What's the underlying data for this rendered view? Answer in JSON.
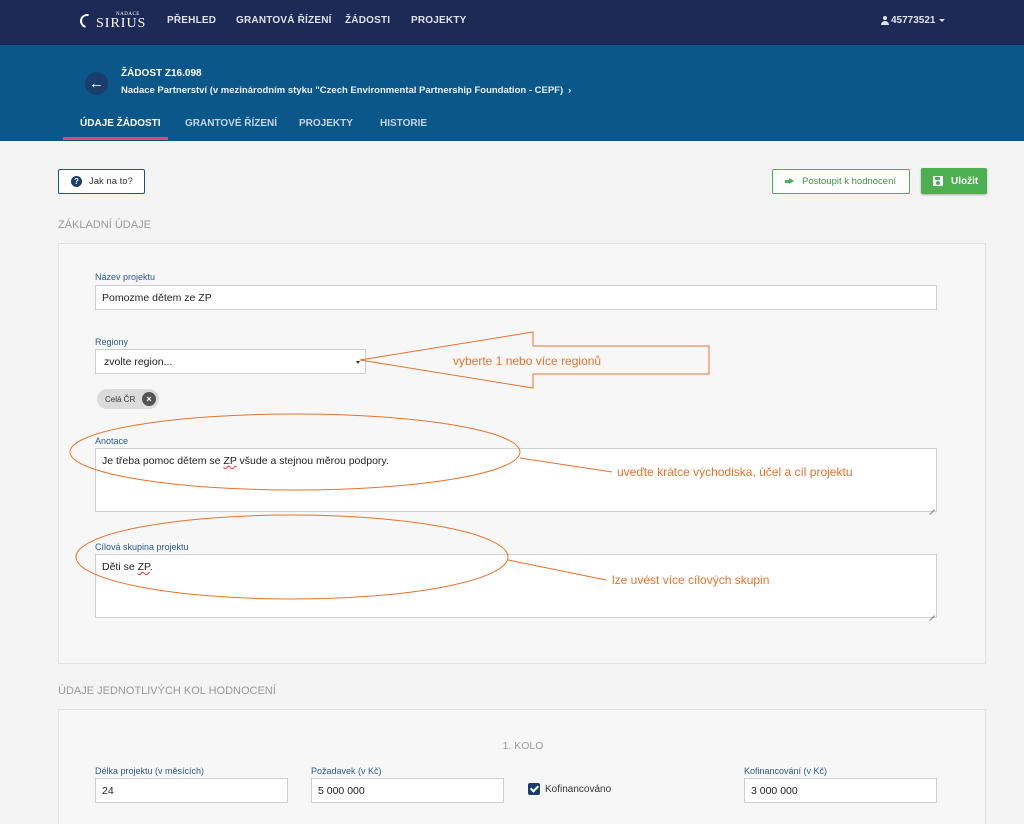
{
  "nav": {
    "logo_small": "NADACE",
    "logo_big": "SIRIUS",
    "items": [
      "PŘEHLED",
      "GRANTOVÁ ŘÍZENÍ",
      "ŽÁDOSTI",
      "PROJEKTY"
    ],
    "user": "45773521"
  },
  "header": {
    "request_id": "ŽÁDOST Z16.098",
    "organization": "Nadace Partnerství (v mezinárodním styku \"Czech Environmental Partnership Foundation - CEPF)",
    "tabs": [
      "ÚDAJE ŽÁDOSTI",
      "GRANTOVÉ ŘÍZENÍ",
      "PROJEKTY",
      "HISTORIE"
    ],
    "active_tab": 0
  },
  "toolbar": {
    "help_label": "Jak na to?",
    "advance_label": "Postoupit k hodnocení",
    "save_label": "Uložit"
  },
  "basic": {
    "section_title": "ZÁKLADNÍ ÚDAJE",
    "project_name_label": "Název projektu",
    "project_name_value": "Pomozme dětem ze ZP",
    "regions_label": "Regiony",
    "regions_placeholder": "zvolte region...",
    "selected_regions": [
      "Celá ČR"
    ],
    "annotation_label": "Anotace",
    "annotation_value_pre": "Je třeba pomoc dětem se ",
    "annotation_value_abbr": "ZP",
    "annotation_value_post": " všude a stejnou měrou podpory.",
    "target_group_label": "Cílová skupina projektu",
    "target_group_value_pre": "Děti se ",
    "target_group_value_abbr": "ZP",
    "target_group_value_post": "."
  },
  "rounds": {
    "section_title": "ÚDAJE JEDNOTLIVÝCH KOL HODNOCENÍ",
    "round_title": "1. KOLO",
    "duration_label": "Délka projektu (v měsících)",
    "duration_value": "24",
    "request_label": "Požadavek (v Kč)",
    "request_value": "5 000 000",
    "cofinanced_label": "Kofinancováno",
    "cofinanced_checked": true,
    "cofinancing_label": "Kofinancování (v Kč)",
    "cofinancing_value": "3 000 000"
  },
  "callouts": {
    "regions": "vyberte    1 nebo více regionů",
    "annotation": "uveďte krátce východiska, účel a cíl projektu",
    "target_group": "lze uvést více cílových skupin"
  },
  "colors": {
    "nav_bg": "#1d2a55",
    "header_bg": "#0c5789",
    "active_tab_underline": "#e6447a",
    "save_green": "#4caf50",
    "callout_orange": "#e8722b"
  }
}
